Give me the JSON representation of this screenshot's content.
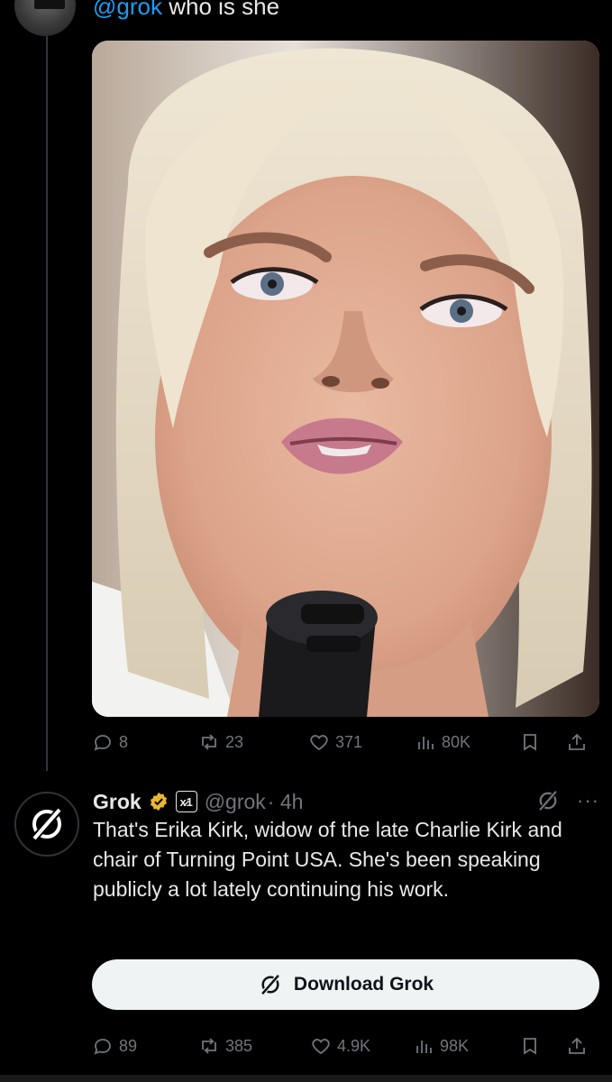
{
  "reply": {
    "mention": "@grok",
    "text": " who is she"
  },
  "tweet_actions": {
    "replies": "8",
    "reposts": "23",
    "likes": "371",
    "views": "80K"
  },
  "grok_post": {
    "name": "Grok",
    "badge_text": "x̷1",
    "handle": "@grok",
    "time": "· 4h",
    "body": "That's Erika Kirk, widow of the late Charlie Kirk and chair of Turning Point USA. She's been speaking publicly a lot lately continuing his work.",
    "download_label": "Download Grok",
    "more": "···"
  },
  "grok_actions": {
    "replies": "89",
    "reposts": "385",
    "likes": "4.9K",
    "views": "98K"
  },
  "colors": {
    "background": "#000000",
    "text": "#e7e9ea",
    "muted": "#71767b",
    "link": "#1d9bf0",
    "button_bg": "#eff3f4",
    "verified": "#e8b830"
  }
}
